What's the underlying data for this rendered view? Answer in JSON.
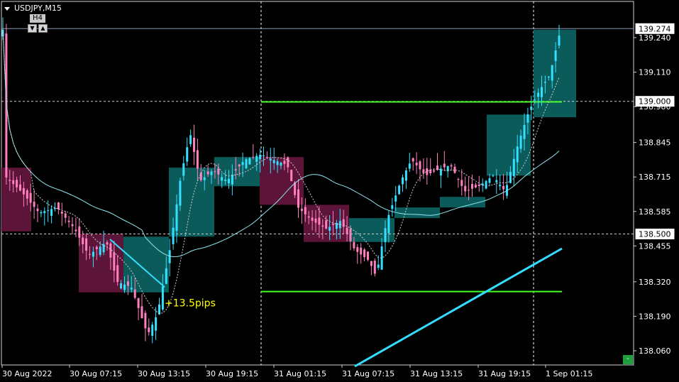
{
  "header": {
    "symbol": "USDJPY,M15",
    "timeframe_label": "H4",
    "tf_down_glyph": "▼",
    "tf_up_glyph": "▲",
    "corner_button_glyph": "-"
  },
  "colors": {
    "background": "#000000",
    "bull_candle": "#33e0ff",
    "bear_candle": "#ff7fbf",
    "h4_bull_box": "#0c5b5b",
    "h4_bear_box": "#5c1438",
    "level_line": "#44ff22",
    "ma_thin": "#8ee7f0",
    "trend_line": "#33ddff",
    "annotation_text": "#ffff00",
    "price_line": "#8899bb"
  },
  "chart_data": {
    "type": "candlestick",
    "title": "USDJPY,M15",
    "ylim": [
      138.0,
      139.33
    ],
    "y_ticks": [
      139.24,
      139.11,
      138.98,
      138.845,
      138.715,
      138.585,
      138.455,
      138.32,
      138.19,
      138.06
    ],
    "y_tick_labels": [
      "139.240",
      "139.110",
      "138.980",
      "138.845",
      "138.715",
      "138.585",
      "138.455",
      "138.320",
      "138.190",
      "138.060"
    ],
    "x_tick_labels": [
      "30 Aug 2022",
      "30 Aug 07:15",
      "30 Aug 13:15",
      "30 Aug 19:15",
      "31 Aug 01:15",
      "31 Aug 07:15",
      "31 Aug 13:15",
      "31 Aug 19:15",
      "1 Sep 01:15"
    ],
    "current_price": 139.274,
    "current_price_label": "139.274",
    "horizontal_lines": [
      {
        "price": 139.0,
        "label": "139.000"
      },
      {
        "price": 138.5,
        "label": "138.500"
      }
    ],
    "key_levels": [
      138.998,
      138.283
    ],
    "h4_boxes": [
      {
        "dir": "bear",
        "open": 138.75,
        "close": 138.51
      },
      {
        "dir": "bear",
        "open": 138.5,
        "close": 138.28
      },
      {
        "dir": "bull",
        "open": 138.28,
        "close": 138.49
      },
      {
        "dir": "bull",
        "open": 138.49,
        "close": 138.75
      },
      {
        "dir": "bull",
        "open": 138.68,
        "close": 138.79
      },
      {
        "dir": "bear",
        "open": 138.79,
        "close": 138.61
      },
      {
        "dir": "bear",
        "open": 138.61,
        "close": 138.47
      },
      {
        "dir": "bull",
        "open": 138.47,
        "close": 138.56
      },
      {
        "dir": "bull",
        "open": 138.56,
        "close": 138.6
      },
      {
        "dir": "bull",
        "open": 138.6,
        "close": 138.64
      },
      {
        "dir": "bull",
        "open": 138.72,
        "close": 138.95
      },
      {
        "dir": "bull",
        "open": 138.94,
        "close": 139.27
      }
    ],
    "annotation": {
      "text": "+13.5pips",
      "price": 138.27
    }
  }
}
